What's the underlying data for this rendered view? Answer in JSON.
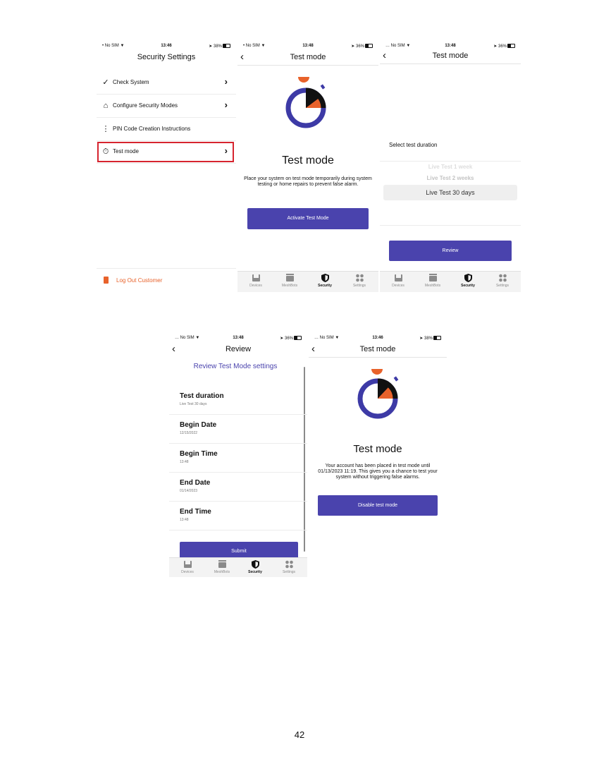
{
  "page_number": "42",
  "status_bars": {
    "s1": {
      "carrier": "No SIM",
      "time": "13:46",
      "battery": "38%"
    },
    "s2": {
      "carrier": "No SIM",
      "time": "13:48",
      "battery": "36%"
    },
    "s3": {
      "carrier": "No SIM",
      "time": "13:48",
      "battery": "36%"
    },
    "s4": {
      "carrier": "No SIM",
      "time": "13:48",
      "battery": "36%"
    },
    "s5": {
      "carrier": "No SIM",
      "time": "13:46",
      "battery": "38%"
    }
  },
  "screen1": {
    "title": "Security Settings",
    "items": [
      {
        "label": "Check System",
        "icon": "check-system-icon"
      },
      {
        "label": "Configure Security Modes",
        "icon": "home-shield-icon"
      },
      {
        "label": "PIN Code Creation Instructions",
        "icon": "pin-pad-icon"
      },
      {
        "label": "Test mode",
        "icon": "stopwatch-icon"
      }
    ],
    "logout_label": "Log Out Customer",
    "highlight_color": "#d6242f"
  },
  "screen2": {
    "title": "Test mode",
    "heading": "Test mode",
    "description": "Place your system on test mode temporarily during system testing or home repairs to prevent false alarm.",
    "button_label": "Activate Test Mode"
  },
  "screen3": {
    "title": "Test mode",
    "select_label": "Select test duration",
    "options_faded": [
      "Live Test 1 week",
      "Live Test 2 weeks"
    ],
    "option_selected": "Live Test 30 days",
    "button_label": "Review"
  },
  "screen4": {
    "title": "Review",
    "section_title": "Review Test Mode settings",
    "fields": [
      {
        "label": "Test duration",
        "value": "Live Test 30 days"
      },
      {
        "label": "Begin Date",
        "value": "12/15/2022"
      },
      {
        "label": "Begin Time",
        "value": "13:48"
      },
      {
        "label": "End Date",
        "value": "01/14/2023"
      },
      {
        "label": "End Time",
        "value": "13:48"
      }
    ],
    "button_label": "Submit"
  },
  "screen5": {
    "title": "Test mode",
    "heading": "Test mode",
    "description": "Your account has been placed in test mode until 01/13/2023 11:19. This gives you a chance to test your system without triggering false alarms.",
    "button_label": "Disable test mode"
  },
  "tabbar": {
    "tabs": [
      "Devices",
      "MeshBots",
      "Security",
      "Settings"
    ],
    "active": "Security"
  },
  "colors": {
    "accent": "#4a43ad",
    "orange": "#e8622b",
    "ring": "#3d3aa6",
    "highlight": "#d6242f"
  }
}
